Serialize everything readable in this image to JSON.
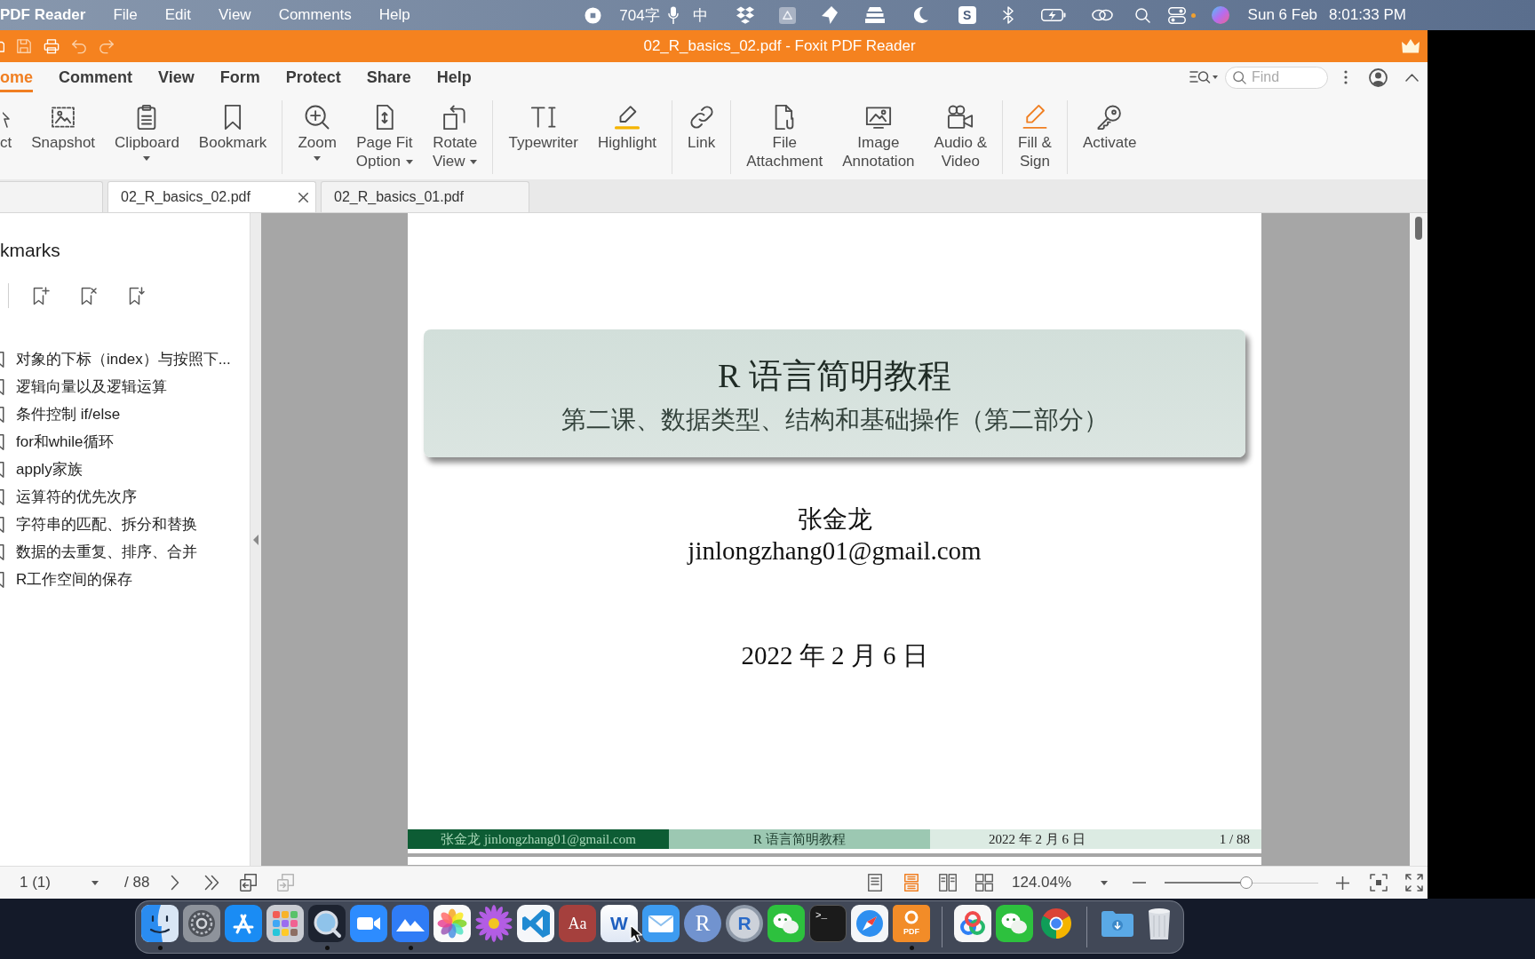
{
  "menubar": {
    "app_name": "PDF Reader",
    "menus": [
      "File",
      "Edit",
      "View",
      "Comments",
      "Help"
    ],
    "word_count": "704字",
    "input_source": "中",
    "tray_logo": "S",
    "date": "Sun 6 Feb",
    "time": "8:01:33 PM"
  },
  "window": {
    "title": "02_R_basics_02.pdf - Foxit PDF Reader"
  },
  "quick_access": [
    {
      "kind": "open",
      "disabled": false
    },
    {
      "kind": "save",
      "disabled": true
    },
    {
      "kind": "print",
      "disabled": false
    },
    {
      "kind": "undo",
      "disabled": true
    },
    {
      "kind": "redo",
      "disabled": true
    }
  ],
  "ribbon_tabs": [
    {
      "label": "ome",
      "selected": true
    },
    {
      "label": "Comment",
      "selected": false
    },
    {
      "label": "View",
      "selected": false
    },
    {
      "label": "Form",
      "selected": false
    },
    {
      "label": "Protect",
      "selected": false
    },
    {
      "label": "Share",
      "selected": false
    },
    {
      "label": "Help",
      "selected": false
    }
  ],
  "find": {
    "placeholder": "Find"
  },
  "toolbar_groups": [
    [
      {
        "kind": "select",
        "label": "ct",
        "dropdown": false
      },
      {
        "kind": "snapshot",
        "label": "Snapshot",
        "dropdown": false
      },
      {
        "kind": "clipboard",
        "label": "Clipboard",
        "dropdown": true
      },
      {
        "kind": "bookmark",
        "label": "Bookmark",
        "dropdown": false
      }
    ],
    [
      {
        "kind": "zoom",
        "label": "Zoom",
        "dropdown": true
      },
      {
        "kind": "page_fit",
        "label": "Page Fit\nOption",
        "dropdown": true
      },
      {
        "kind": "rotate",
        "label": "Rotate\nView",
        "dropdown": true
      }
    ],
    [
      {
        "kind": "typewriter",
        "label": "Typewriter",
        "dropdown": false
      },
      {
        "kind": "highlight",
        "label": "Highlight",
        "dropdown": false
      }
    ],
    [
      {
        "kind": "link",
        "label": "Link",
        "dropdown": false
      }
    ],
    [
      {
        "kind": "attachment",
        "label": "File\nAttachment",
        "dropdown": false
      },
      {
        "kind": "image",
        "label": "Image\nAnnotation",
        "dropdown": false
      },
      {
        "kind": "media",
        "label": "Audio &\nVideo",
        "dropdown": false
      }
    ],
    [
      {
        "kind": "sign",
        "label": "Fill &\nSign",
        "dropdown": false
      }
    ],
    [
      {
        "kind": "activate",
        "label": "Activate",
        "dropdown": false
      }
    ]
  ],
  "doc_tabs": [
    {
      "selected": false
    },
    {
      "label": "02_R_basics_02.pdf",
      "selected": true
    },
    {
      "label": "02_R_basics_01.pdf",
      "selected": false
    }
  ],
  "sidebar": {
    "title": "kmarks",
    "bookmarks": [
      {
        "label": "对象的下标（index）与按照下...",
        "selected": false
      },
      {
        "label": "逻辑向量以及逻辑运算",
        "selected": false
      },
      {
        "label": "条件控制 if/else",
        "selected": false
      },
      {
        "label": "for和while循环",
        "selected": false
      },
      {
        "label": "apply家族",
        "selected": false
      },
      {
        "label": "运算符的优先次序",
        "selected": false
      },
      {
        "label": "字符串的匹配、拆分和替换",
        "selected": false
      },
      {
        "label": "数据的去重复、排序、合并",
        "selected": false
      },
      {
        "label": "R工作空间的保存",
        "selected": false
      }
    ]
  },
  "page": {
    "title": "R 语言简明教程",
    "subtitle": "第二课、数据类型、结构和基础操作（第二部分）",
    "author": "张金龙",
    "email": "jinlongzhang01@gmail.com",
    "date": "2022 年 2 月 6 日",
    "footer": {
      "author": "张金龙 jinlongzhang01@gmail.com",
      "title": "R 语言简明教程",
      "date": "2022 年 2 月 6 日",
      "page": "1 / 88"
    }
  },
  "status_bar": {
    "page_field": "1 (1)",
    "page_total": "/ 88",
    "nav": [
      {
        "kind": "next",
        "disabled": false
      },
      {
        "kind": "last",
        "disabled": false
      },
      {
        "kind": "previous_view",
        "disabled": false
      },
      {
        "kind": "next_view",
        "disabled": true
      }
    ],
    "view_modes": [
      {
        "kind": "single",
        "selected": false
      },
      {
        "kind": "continuous",
        "selected": true
      },
      {
        "kind": "facing",
        "selected": false
      },
      {
        "kind": "continuous_facing",
        "selected": false
      }
    ],
    "zoom": "124.04%",
    "zoom_slider": {
      "level": 0.53
    }
  },
  "dock": {
    "groups": [
      [
        {
          "kind": "finder",
          "running": true
        },
        {
          "kind": "settings",
          "running": false
        },
        {
          "kind": "app_store",
          "running": false
        },
        {
          "kind": "launchpad",
          "running": false
        },
        {
          "kind": "quicktime",
          "running": true
        },
        {
          "kind": "zoom",
          "running": false
        },
        {
          "kind": "mountains",
          "running": true
        },
        {
          "kind": "photos",
          "running": false
        },
        {
          "kind": "flower",
          "running": false
        },
        {
          "kind": "vscode",
          "running": false
        },
        {
          "kind": "dictionary",
          "glyph": "Aa",
          "running": false
        },
        {
          "kind": "word",
          "glyph": "W",
          "running": false
        },
        {
          "kind": "mail",
          "running": false
        },
        {
          "kind": "r",
          "glyph": "R",
          "running": false
        },
        {
          "kind": "rstudio",
          "glyph": "R",
          "running": false
        },
        {
          "kind": "wechat",
          "running": false
        },
        {
          "kind": "terminal",
          "glyph": ">_",
          "running": false
        },
        {
          "kind": "safari",
          "running": false
        },
        {
          "kind": "foxit",
          "glyph": "PDF",
          "running": true
        }
      ],
      [
        {
          "kind": "netdisk",
          "running": false
        },
        {
          "kind": "wechat",
          "running": false
        },
        {
          "kind": "chrome",
          "running": false
        }
      ],
      [
        {
          "kind": "downloads",
          "running": false
        },
        {
          "kind": "trash",
          "running": false
        }
      ]
    ]
  }
}
